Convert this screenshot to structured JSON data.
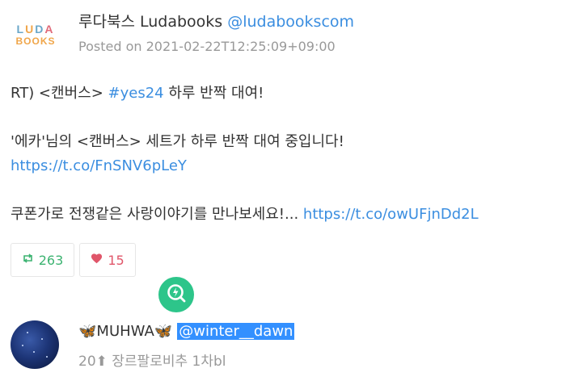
{
  "post": {
    "logo": {
      "row1": [
        "LU",
        "D",
        "A",
        ""
      ],
      "row2": "BOOKS",
      "text": "LUDA BOOKS"
    },
    "author_name": "루다북스 Ludabooks",
    "author_handle": "@ludabookscom",
    "posted": "Posted on 2021-02-22T12:25:09+09:00",
    "line1_prefix": "RT) <캔버스> ",
    "line1_hashtag": "#yes24",
    "line1_suffix": " 하루 반짝 대여!",
    "line2": "'에카'님의 <캔버스> 세트가 하루 반짝 대여 중입니다!",
    "link1": "https://t.co/FnSNV6pLeY",
    "line3_text": "쿠폰가로 전쟁같은 사랑이야기를 만나보세요!... ",
    "link2": "https://t.co/owUFjnDd2L",
    "retweet_count": "263",
    "like_count": "15",
    "colors": {
      "link": "#3b8ee0",
      "retweet": "#3cb371",
      "like": "#e0566a",
      "badge": "#2dc58a"
    }
  },
  "user": {
    "name_prefix": "🦋",
    "name": "MUHWA",
    "name_suffix": "🦋",
    "handle": "@winter__dawn",
    "status": "20⬆ 장르팔로비추 1차bl"
  }
}
